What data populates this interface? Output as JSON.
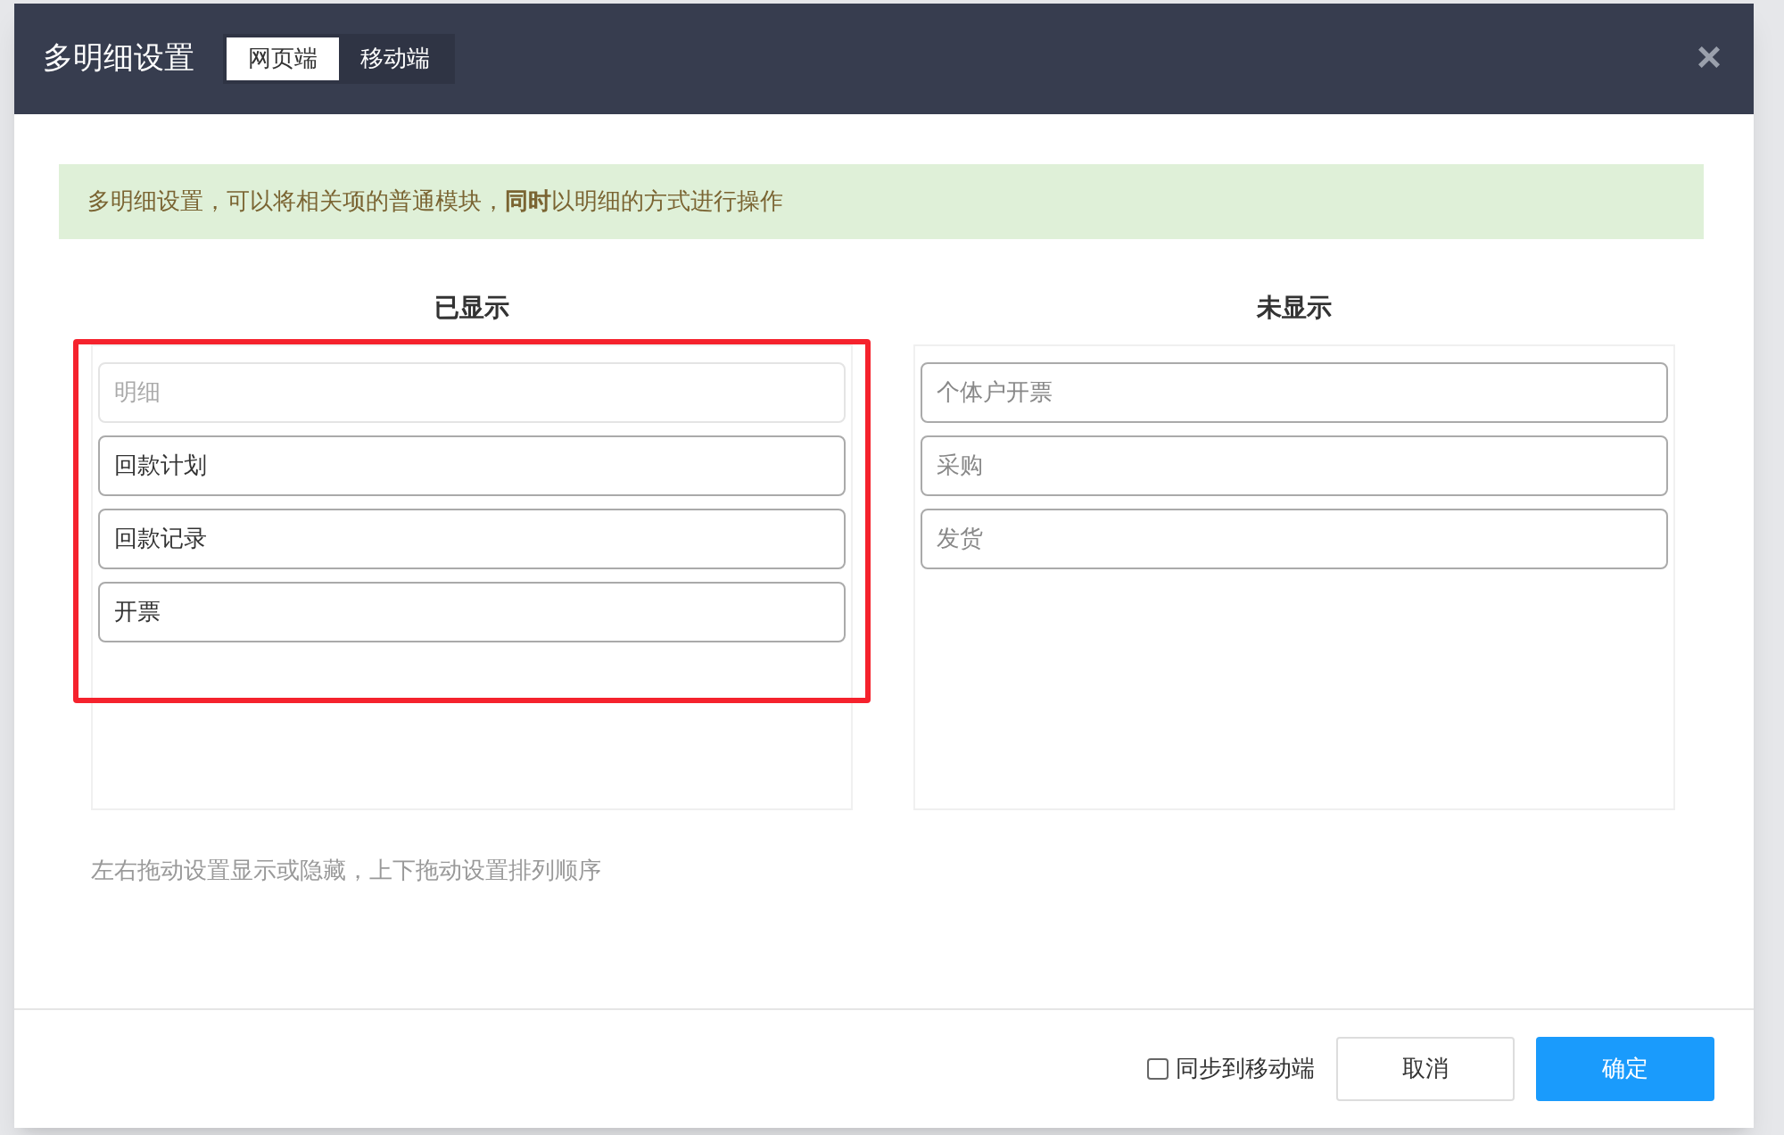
{
  "dialog": {
    "title": "多明细设置",
    "tabs": [
      {
        "label": "网页端",
        "selected": true
      },
      {
        "label": "移动端",
        "selected": false
      }
    ],
    "close": "×",
    "notice": "多明细设置，可以将相关项的普通模块，**同时**以明细的方式进行操作",
    "columns": [
      {
        "heading": "已显示",
        "kind": "shown",
        "highlighted": true,
        "items": [
          {
            "label": "明细",
            "disabled": true
          },
          {
            "label": "回款计划",
            "disabled": false
          },
          {
            "label": "回款记录",
            "disabled": false
          },
          {
            "label": "开票",
            "disabled": false
          }
        ]
      },
      {
        "heading": "未显示",
        "kind": "hidden",
        "highlighted": false,
        "items": [
          {
            "label": "个体户开票",
            "disabled": false
          },
          {
            "label": "采购",
            "disabled": false
          },
          {
            "label": "发货",
            "disabled": false
          }
        ]
      }
    ],
    "hint": "左右拖动设置显示或隐藏，上下拖动设置排列顺序",
    "sync": {
      "label": "同步到移动端",
      "checked": false
    },
    "buttons": [
      {
        "label": "取消",
        "kind": "secondary"
      },
      {
        "label": "确定",
        "kind": "primary"
      }
    ]
  }
}
